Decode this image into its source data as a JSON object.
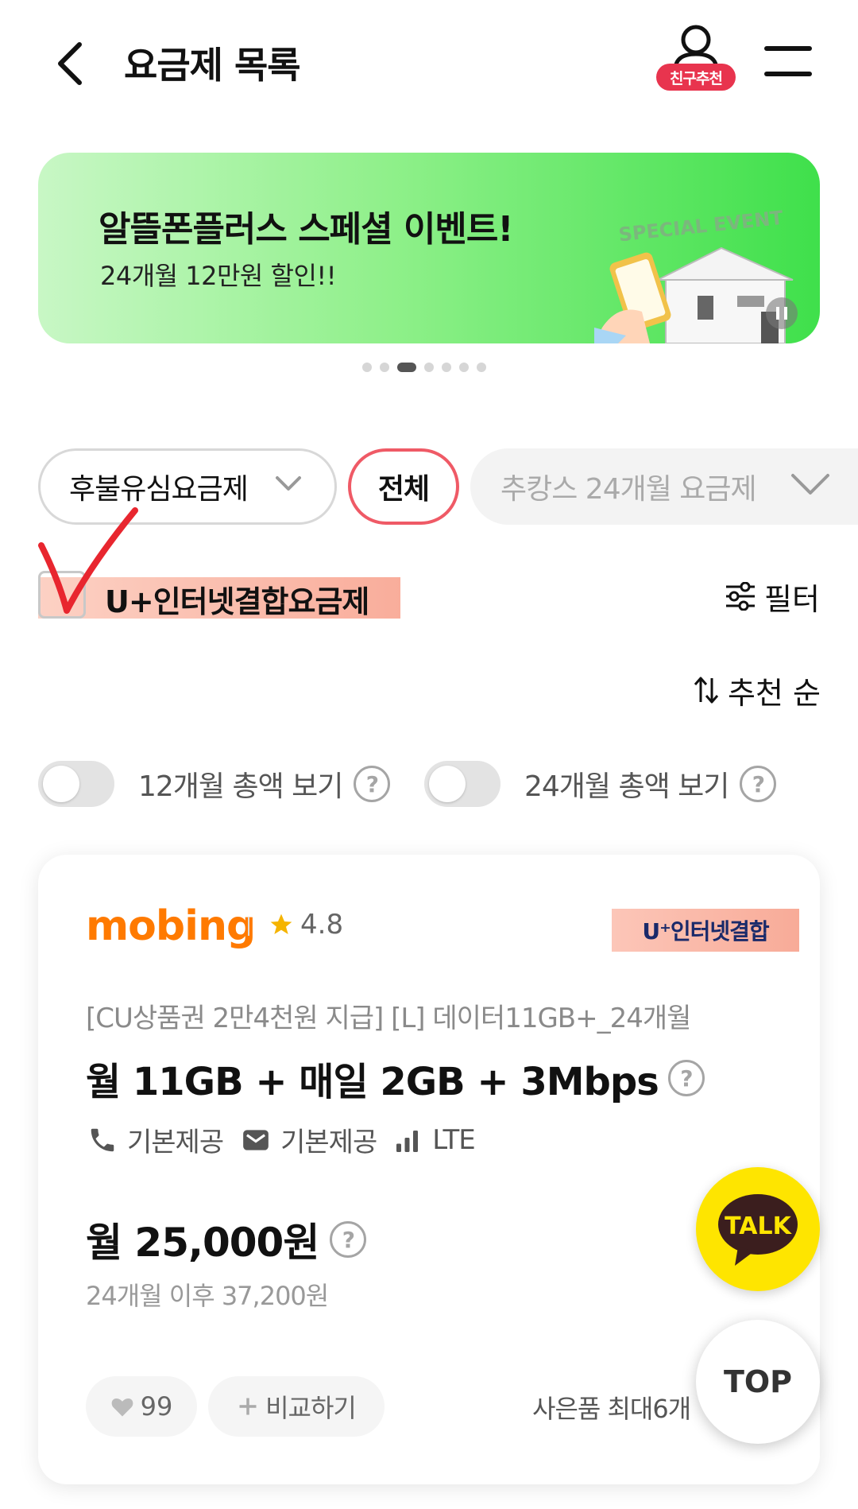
{
  "header": {
    "title": "요금제 목록",
    "friend_badge": "친구추천"
  },
  "banner": {
    "title": "알뜰폰플러스 스페셜 이벤트!",
    "subtitle": "24개월 12만원 할인!!",
    "art_text": "SPECIAL EVENT",
    "slide_count": 7,
    "active_slide": 3
  },
  "filters": {
    "category": "후불유심요금제",
    "all": "전체",
    "event": "추캉스 24개월 요금제"
  },
  "checkbox": {
    "label": "U+인터넷결합요금제",
    "checked": false
  },
  "filter_label": "필터",
  "sort_label": "추천 순",
  "toggles": [
    {
      "label": "12개월 총액 보기",
      "on": false
    },
    {
      "label": "24개월 총액 보기",
      "on": false
    }
  ],
  "card": {
    "brand": "mobing",
    "rating": "4.8",
    "badge": "U⁺인터넷결합",
    "sub_title": "[CU상품권 2만4천원 지급] [L] 데이터11GB+_24개월",
    "plan_name": "월 11GB + 매일 2GB + 3Mbps",
    "features": [
      {
        "icon": "phone-icon",
        "text": "기본제공"
      },
      {
        "icon": "message-icon",
        "text": "기본제공"
      },
      {
        "icon": "signal-icon",
        "text": "LTE"
      }
    ],
    "price": "월 25,000원",
    "price_after": "24개월 이후 37,200원",
    "likes": "99",
    "compare": "비교하기",
    "gift": "사은품 최대6개"
  },
  "floating": {
    "talk": "TALK",
    "top": "TOP"
  },
  "colors": {
    "accent_red": "#ef5a66",
    "banner_green": "#3fe04b",
    "highlight": "#f9ad9b",
    "brand_orange": "#ff7a00",
    "kakao_yellow": "#fee500"
  }
}
